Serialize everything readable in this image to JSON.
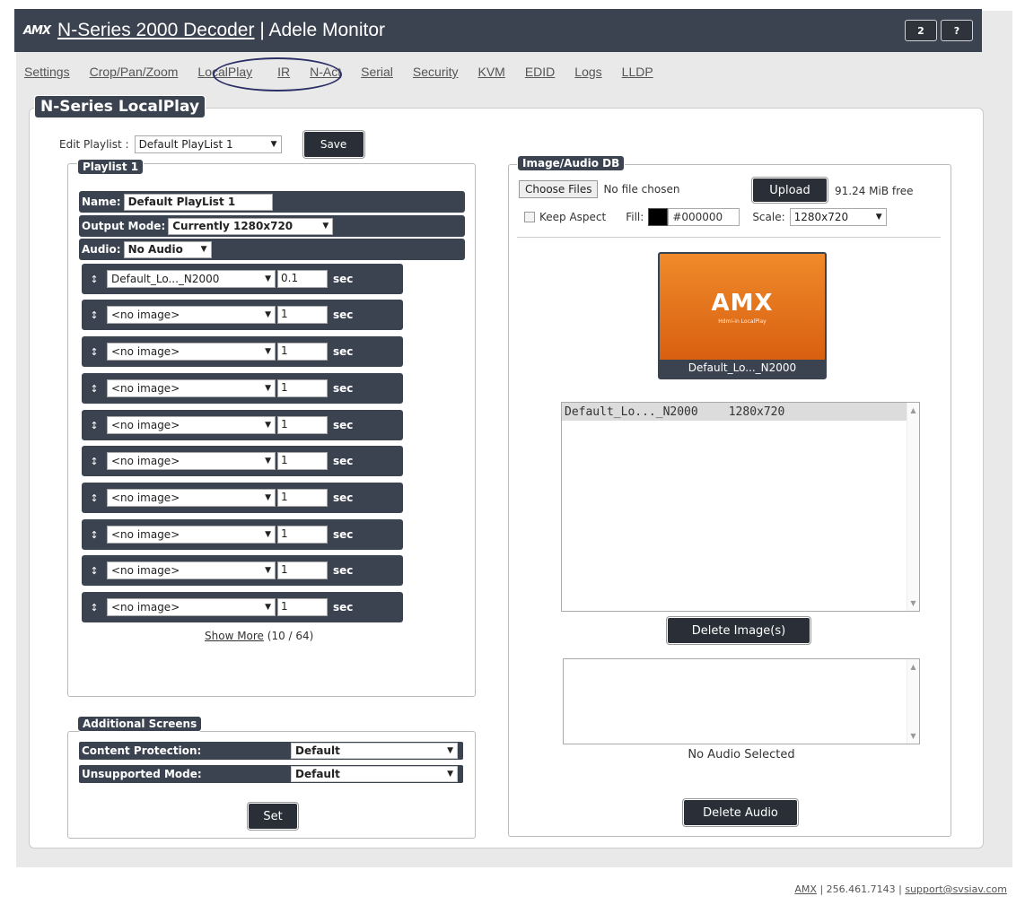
{
  "header": {
    "logo": "AMX",
    "title_link": "N-Series 2000 Decoder",
    "title_sep": " | ",
    "title_device": "Adele Monitor",
    "user_button": "2",
    "help_button": "?"
  },
  "nav": {
    "tabs": [
      "Settings",
      "Crop/Pan/Zoom",
      "LocalPlay",
      "IR",
      "N-Act",
      "Serial",
      "Security",
      "KVM",
      "EDID",
      "Logs",
      "LLDP"
    ],
    "active": "LocalPlay"
  },
  "localplay": {
    "legend": "N-Series LocalPlay",
    "edit_label": "Edit Playlist :",
    "edit_value": "Default PlayList 1",
    "save_label": "Save"
  },
  "playlist": {
    "legend": "Playlist 1",
    "name_label": "Name:",
    "name_value": "Default PlayList 1",
    "output_label": "Output Mode:",
    "output_value": "Currently 1280x720",
    "audio_label": "Audio:",
    "audio_value": "No Audio",
    "sec_label": "sec",
    "entries": [
      {
        "image": "Default_Lo..._N2000",
        "duration": "0.1"
      },
      {
        "image": "<no image>",
        "duration": "1"
      },
      {
        "image": "<no image>",
        "duration": "1"
      },
      {
        "image": "<no image>",
        "duration": "1"
      },
      {
        "image": "<no image>",
        "duration": "1"
      },
      {
        "image": "<no image>",
        "duration": "1"
      },
      {
        "image": "<no image>",
        "duration": "1"
      },
      {
        "image": "<no image>",
        "duration": "1"
      },
      {
        "image": "<no image>",
        "duration": "1"
      },
      {
        "image": "<no image>",
        "duration": "1"
      }
    ],
    "show_more_link": "Show More",
    "show_more_count": "(10 / 64)"
  },
  "additional": {
    "legend": "Additional Screens",
    "content_protection_label": "Content Protection:",
    "content_protection_value": "Default",
    "unsupported_label": "Unsupported Mode:",
    "unsupported_value": "Default",
    "set_label": "Set"
  },
  "imagedb": {
    "legend": "Image/Audio DB",
    "choose_files": "Choose Files",
    "no_file": "No file chosen",
    "upload": "Upload",
    "free": "91.24 MiB free",
    "keep_aspect": "Keep Aspect",
    "fill_label": "Fill:",
    "fill_color": "#000000",
    "scale_label": "Scale:",
    "scale_value": "1280x720",
    "thumb_caption": "Default_Lo..._N2000",
    "thumb_logo": "AMX",
    "thumb_subtitle": "Hdmi-in LocalPlay",
    "list_item_name": "Default_Lo..._N2000",
    "list_item_res": "1280x720",
    "delete_images": "Delete Image(s)",
    "no_audio": "No Audio Selected",
    "delete_audio": "Delete Audio"
  },
  "footer": {
    "brand": "AMX",
    "phone": " | 256.461.7143 | ",
    "email": "support@svsiav.com"
  }
}
